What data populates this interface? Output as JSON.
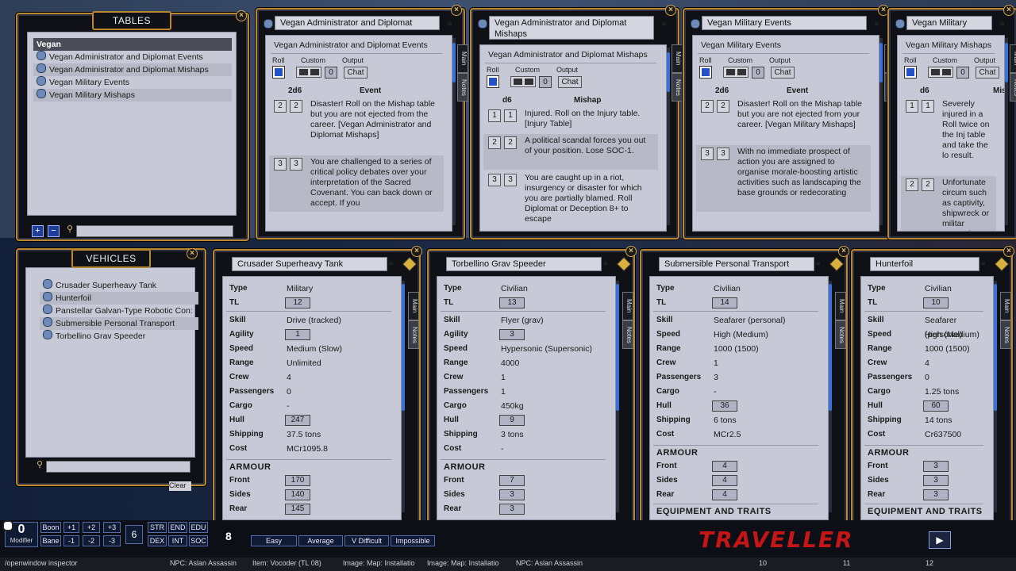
{
  "tables_panel": {
    "title": "TABLES",
    "items": [
      {
        "label": "Vegan",
        "type": "group"
      },
      {
        "label": "Vegan Administrator and Diplomat Events"
      },
      {
        "label": "Vegan Administrator and Diplomat Mishaps"
      },
      {
        "label": "Vegan Military Events"
      },
      {
        "label": "Vegan Military Mishaps"
      }
    ]
  },
  "vehicles_panel": {
    "title": "VEHICLES",
    "items": [
      {
        "label": "Crusader Superheavy Tank"
      },
      {
        "label": "Hunterfoil"
      },
      {
        "label": "Panstellar Galvan-Type Robotic Con:"
      },
      {
        "label": "Submersible Personal Transport"
      },
      {
        "label": "Torbellino Grav Speeder"
      }
    ],
    "partial_label": "Clear"
  },
  "table_windows": [
    {
      "title": "Vegan Administrator and Diplomat Events",
      "subtitle": "Vegan Administrator and Diplomat Events",
      "roll": "Roll",
      "custom": "Custom",
      "output": "Output",
      "custom_value": "0",
      "chat": "Chat",
      "dice_col": "2d6",
      "event_col": "Event",
      "rows": [
        {
          "dice": [
            "2",
            "2"
          ],
          "text": "Disaster! Roll on the Mishap table but you are not ejected from the career. [Vegan Administrator and Diplomat Mishaps]"
        },
        {
          "dice": [
            "3",
            "3"
          ],
          "text": "You are challenged to a series of critical policy debates over your interpretation of the Sacred Covenant. You can back down or accept. If you"
        }
      ],
      "side_tabs": [
        "Main",
        "Notes"
      ]
    },
    {
      "title": "Vegan Administrator and Diplomat Mishaps",
      "subtitle": "Vegan Administrator and Diplomat Mishaps",
      "roll": "Roll",
      "custom": "Custom",
      "output": "Output",
      "custom_value": "0",
      "chat": "Chat",
      "dice_col": "d6",
      "event_col": "Mishap",
      "rows": [
        {
          "dice": [
            "1",
            "1"
          ],
          "text": "Injured. Roll on the Injury table. [Injury Table]"
        },
        {
          "dice": [
            "2",
            "2"
          ],
          "text": "A political scandal forces you out of your position. Lose SOC-1."
        },
        {
          "dice": [
            "3",
            "3"
          ],
          "text": "You are caught up in a riot, insurgency or disaster for which you are partially blamed. Roll Diplomat or Deception 8+ to escape"
        }
      ],
      "side_tabs": [
        "Main",
        "Notes"
      ]
    },
    {
      "title": "Vegan Military Events",
      "subtitle": "Vegan Military Events",
      "roll": "Roll",
      "custom": "Custom",
      "output": "Output",
      "custom_value": "0",
      "chat": "Chat",
      "dice_col": "2d6",
      "event_col": "Event",
      "rows": [
        {
          "dice": [
            "2",
            "2"
          ],
          "text": "Disaster! Roll on the Mishap table but you are not ejected from your career. [Vegan Military Mishaps]"
        },
        {
          "dice": [
            "3",
            "3"
          ],
          "text": "With no immediate prospect of action you are assigned to organise morale-boosting artistic activities such as landscaping the base grounds or redecorating"
        }
      ],
      "side_tabs": [
        "Main",
        "Notes"
      ]
    },
    {
      "title": "Vegan Military Mishaps",
      "subtitle": "Vegan Military Mishaps",
      "roll": "Roll",
      "custom": "Custom",
      "output": "Output",
      "custom_value": "0",
      "chat": "Chat",
      "dice_col": "d6",
      "event_col": "Mishap",
      "rows": [
        {
          "dice": [
            "1",
            "1"
          ],
          "text": "Severely injured in a Roll twice on the Inj table and take the lo result."
        },
        {
          "dice": [
            "2",
            "2"
          ],
          "text": "Unfortunate circum such as captivity, shipwreck or militar necessity result in y being stranded in a gravity environme lengthy period of tin Reduce STR or END"
        }
      ],
      "side_tabs": [
        "Main",
        "Notes"
      ]
    }
  ],
  "vehicle_windows": [
    {
      "title": "Crusader Superheavy Tank",
      "fields": [
        {
          "k": "Type",
          "v": "Military"
        },
        {
          "k": "TL",
          "v": "12",
          "boxed": true
        },
        {
          "k": "Skill",
          "v": "Drive (tracked)"
        },
        {
          "k": "Agility",
          "v": "1",
          "boxed": true
        },
        {
          "k": "Speed",
          "v": "Medium (Slow)"
        },
        {
          "k": "Range",
          "v": "Unlimited"
        },
        {
          "k": "Crew",
          "v": "4"
        },
        {
          "k": "Passengers",
          "v": "0"
        },
        {
          "k": "Cargo",
          "v": "-"
        },
        {
          "k": "Hull",
          "v": "247",
          "boxed": true
        },
        {
          "k": "Shipping",
          "v": "37.5 tons"
        },
        {
          "k": "Cost",
          "v": "MCr1095.8"
        }
      ],
      "armour_title": "ARMOUR",
      "armour": [
        {
          "k": "Front",
          "v": "170"
        },
        {
          "k": "Sides",
          "v": "140"
        },
        {
          "k": "Rear",
          "v": "145"
        }
      ],
      "side_tabs": [
        "Main",
        "Notes"
      ]
    },
    {
      "title": "Torbellino Grav Speeder",
      "fields": [
        {
          "k": "Type",
          "v": "Civilian"
        },
        {
          "k": "TL",
          "v": "13",
          "boxed": true
        },
        {
          "k": "Skill",
          "v": "Flyer (grav)"
        },
        {
          "k": "Agility",
          "v": "3",
          "boxed": true
        },
        {
          "k": "Speed",
          "v": "Hypersonic (Supersonic)"
        },
        {
          "k": "Range",
          "v": "4000"
        },
        {
          "k": "Crew",
          "v": "1"
        },
        {
          "k": "Passengers",
          "v": "1"
        },
        {
          "k": "Cargo",
          "v": "450kg"
        },
        {
          "k": "Hull",
          "v": "9",
          "boxed": true
        },
        {
          "k": "Shipping",
          "v": "3 tons"
        },
        {
          "k": "Cost",
          "v": "-"
        }
      ],
      "armour_title": "ARMOUR",
      "armour": [
        {
          "k": "Front",
          "v": "7"
        },
        {
          "k": "Sides",
          "v": "3"
        },
        {
          "k": "Rear",
          "v": "3"
        }
      ],
      "side_tabs": [
        "Main",
        "Notes"
      ]
    },
    {
      "title": "Submersible Personal Transport",
      "fields": [
        {
          "k": "Type",
          "v": "Civilian"
        },
        {
          "k": "TL",
          "v": "14",
          "boxed": true
        },
        {
          "k": "Skill",
          "v": "Seafarer (personal)"
        },
        {
          "k": "Speed",
          "v": "High (Medium)"
        },
        {
          "k": "Range",
          "v": "1000 (1500)"
        },
        {
          "k": "Crew",
          "v": "1"
        },
        {
          "k": "Passengers",
          "v": "3"
        },
        {
          "k": "Cargo",
          "v": "-"
        },
        {
          "k": "Hull",
          "v": "36",
          "boxed": true
        },
        {
          "k": "Shipping",
          "v": "6 tons"
        },
        {
          "k": "Cost",
          "v": "MCr2.5"
        }
      ],
      "armour_title": "ARMOUR",
      "armour": [
        {
          "k": "Front",
          "v": "4"
        },
        {
          "k": "Sides",
          "v": "4"
        },
        {
          "k": "Rear",
          "v": "4"
        }
      ],
      "equip_title": "EQUIPMENT AND TRAITS",
      "side_tabs": [
        "Main",
        "Notes"
      ]
    },
    {
      "title": "Hunterfoil",
      "fields": [
        {
          "k": "Type",
          "v": "Civilian"
        },
        {
          "k": "TL",
          "v": "10",
          "boxed": true
        },
        {
          "k": "Skill",
          "v": "Seafarer (personal)"
        },
        {
          "k": "Speed",
          "v": "High (Medium)"
        },
        {
          "k": "Range",
          "v": "1000 (1500)"
        },
        {
          "k": "Crew",
          "v": "4"
        },
        {
          "k": "Passengers",
          "v": "0"
        },
        {
          "k": "Cargo",
          "v": "1.25 tons"
        },
        {
          "k": "Hull",
          "v": "60",
          "boxed": true
        },
        {
          "k": "Shipping",
          "v": "14 tons"
        },
        {
          "k": "Cost",
          "v": "Cr637500"
        }
      ],
      "armour_title": "ARMOUR",
      "armour": [
        {
          "k": "Front",
          "v": "3"
        },
        {
          "k": "Sides",
          "v": "3"
        },
        {
          "k": "Rear",
          "v": "3"
        }
      ],
      "equip_title": "EQUIPMENT AND TRAITS",
      "side_tabs": [
        "Main",
        "Notes"
      ]
    }
  ],
  "bottom": {
    "modifier_value": "0",
    "modifier_label": "Modifier",
    "boon": "Boon",
    "bane": "Bane",
    "plus": [
      "+1",
      "+2",
      "+3"
    ],
    "minus": [
      "-1",
      "-2",
      "-3"
    ],
    "dice_count": "6",
    "stats_top": [
      "STR",
      "END",
      "EDU"
    ],
    "stats_bot": [
      "DEX",
      "INT",
      "SOC"
    ],
    "target": "8",
    "difficulty": [
      "Easy",
      "Average",
      "V Difficult",
      "Impossible"
    ],
    "brand": "TRAVELLER",
    "play_icon": "▶"
  },
  "status_bar": {
    "items": [
      "/openwindow inspector",
      "NPC: Aslan Assassin",
      "Item: Vocoder (TL 08)",
      "Image: Map: Installatio",
      "Image: Map: Installatio",
      "NPC: Aslan Assassin"
    ],
    "numbers": [
      "10",
      "11",
      "12"
    ]
  },
  "colors": {
    "frame_gold": "#b8872f",
    "paper": "#c7c9d6",
    "accent_blue": "#2351c8",
    "brand_red": "#c41616"
  }
}
